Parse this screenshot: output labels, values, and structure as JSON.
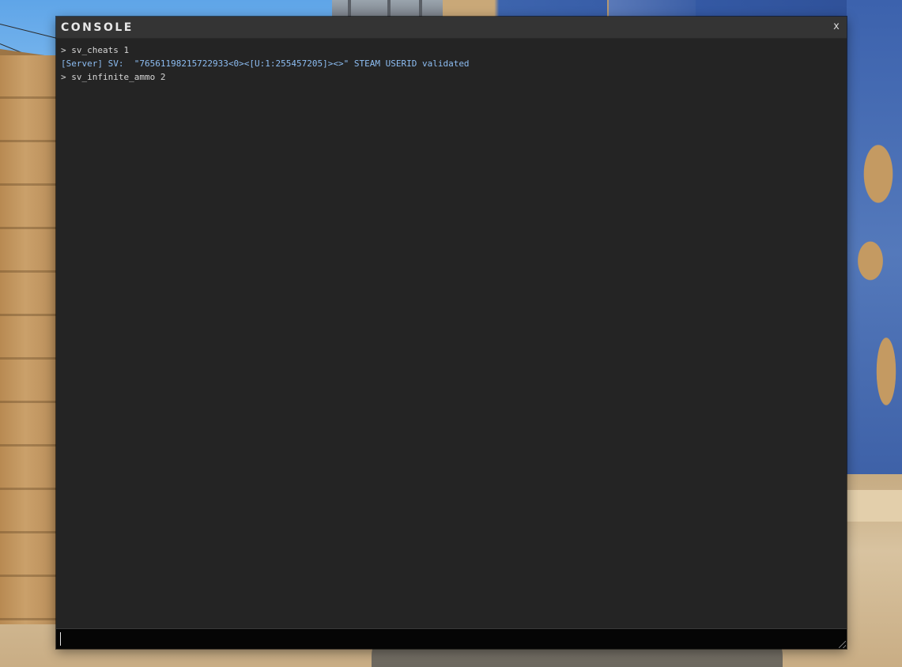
{
  "console": {
    "title": "CONSOLE",
    "close_label": "x",
    "lines": [
      {
        "kind": "cmd",
        "text": "> sv_cheats 1"
      },
      {
        "kind": "server",
        "text": "[Server] SV:  \"76561198215722933<0><[U:1:255457205]><>\" STEAM USERID validated"
      },
      {
        "kind": "cmd",
        "text": "> sv_infinite_ammo 2"
      }
    ],
    "input": {
      "value": "",
      "placeholder": ""
    }
  },
  "colors": {
    "window_bg": "#242424",
    "titlebar_bg": "#343434",
    "command_text": "#d6d6d6",
    "server_text": "#8dbdf2",
    "input_bg": "#050505"
  }
}
